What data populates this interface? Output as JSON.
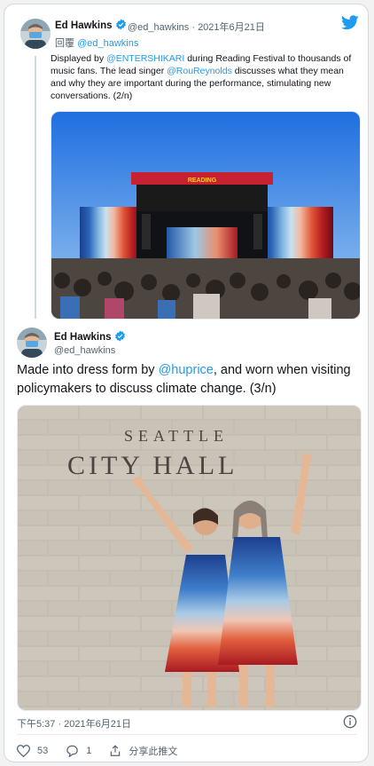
{
  "tweet1": {
    "name": "Ed Hawkins",
    "handle": "@ed_hawkins",
    "separator": "·",
    "date": "2021年6月21日",
    "reply_prefix": "回覆",
    "reply_to": "@ed_hawkins",
    "text_1": "Displayed by ",
    "mention_1": "@ENTERSHIKARI",
    "text_2": " during Reading Festival to thousands of music fans. The lead singer ",
    "mention_2": "@RouReynolds",
    "text_3": " discusses what they mean and why they are important during the performance, stimulating new conversations. (2/n)",
    "stage_banner": "READING"
  },
  "tweet2": {
    "name": "Ed Hawkins",
    "handle": "@ed_hawkins",
    "text_1": "Made into dress form by ",
    "mention": "@huprice",
    "text_2": ", and worn when visiting policymakers to discuss climate change. (3/n)",
    "sign_line1": "SEATTLE",
    "sign_line2": "CITY HALL",
    "timestamp": "下午5:37 · 2021年6月21日",
    "actions": {
      "likes": "53",
      "replies": "1",
      "share_label": "分享此推文"
    }
  },
  "colors": {
    "accent": "#1d9bf0",
    "text": "#0f1419",
    "muted": "#536471"
  },
  "icons": [
    "twitter-bird-icon",
    "verified-badge-icon",
    "info-icon",
    "heart-icon",
    "reply-icon",
    "share-icon"
  ]
}
